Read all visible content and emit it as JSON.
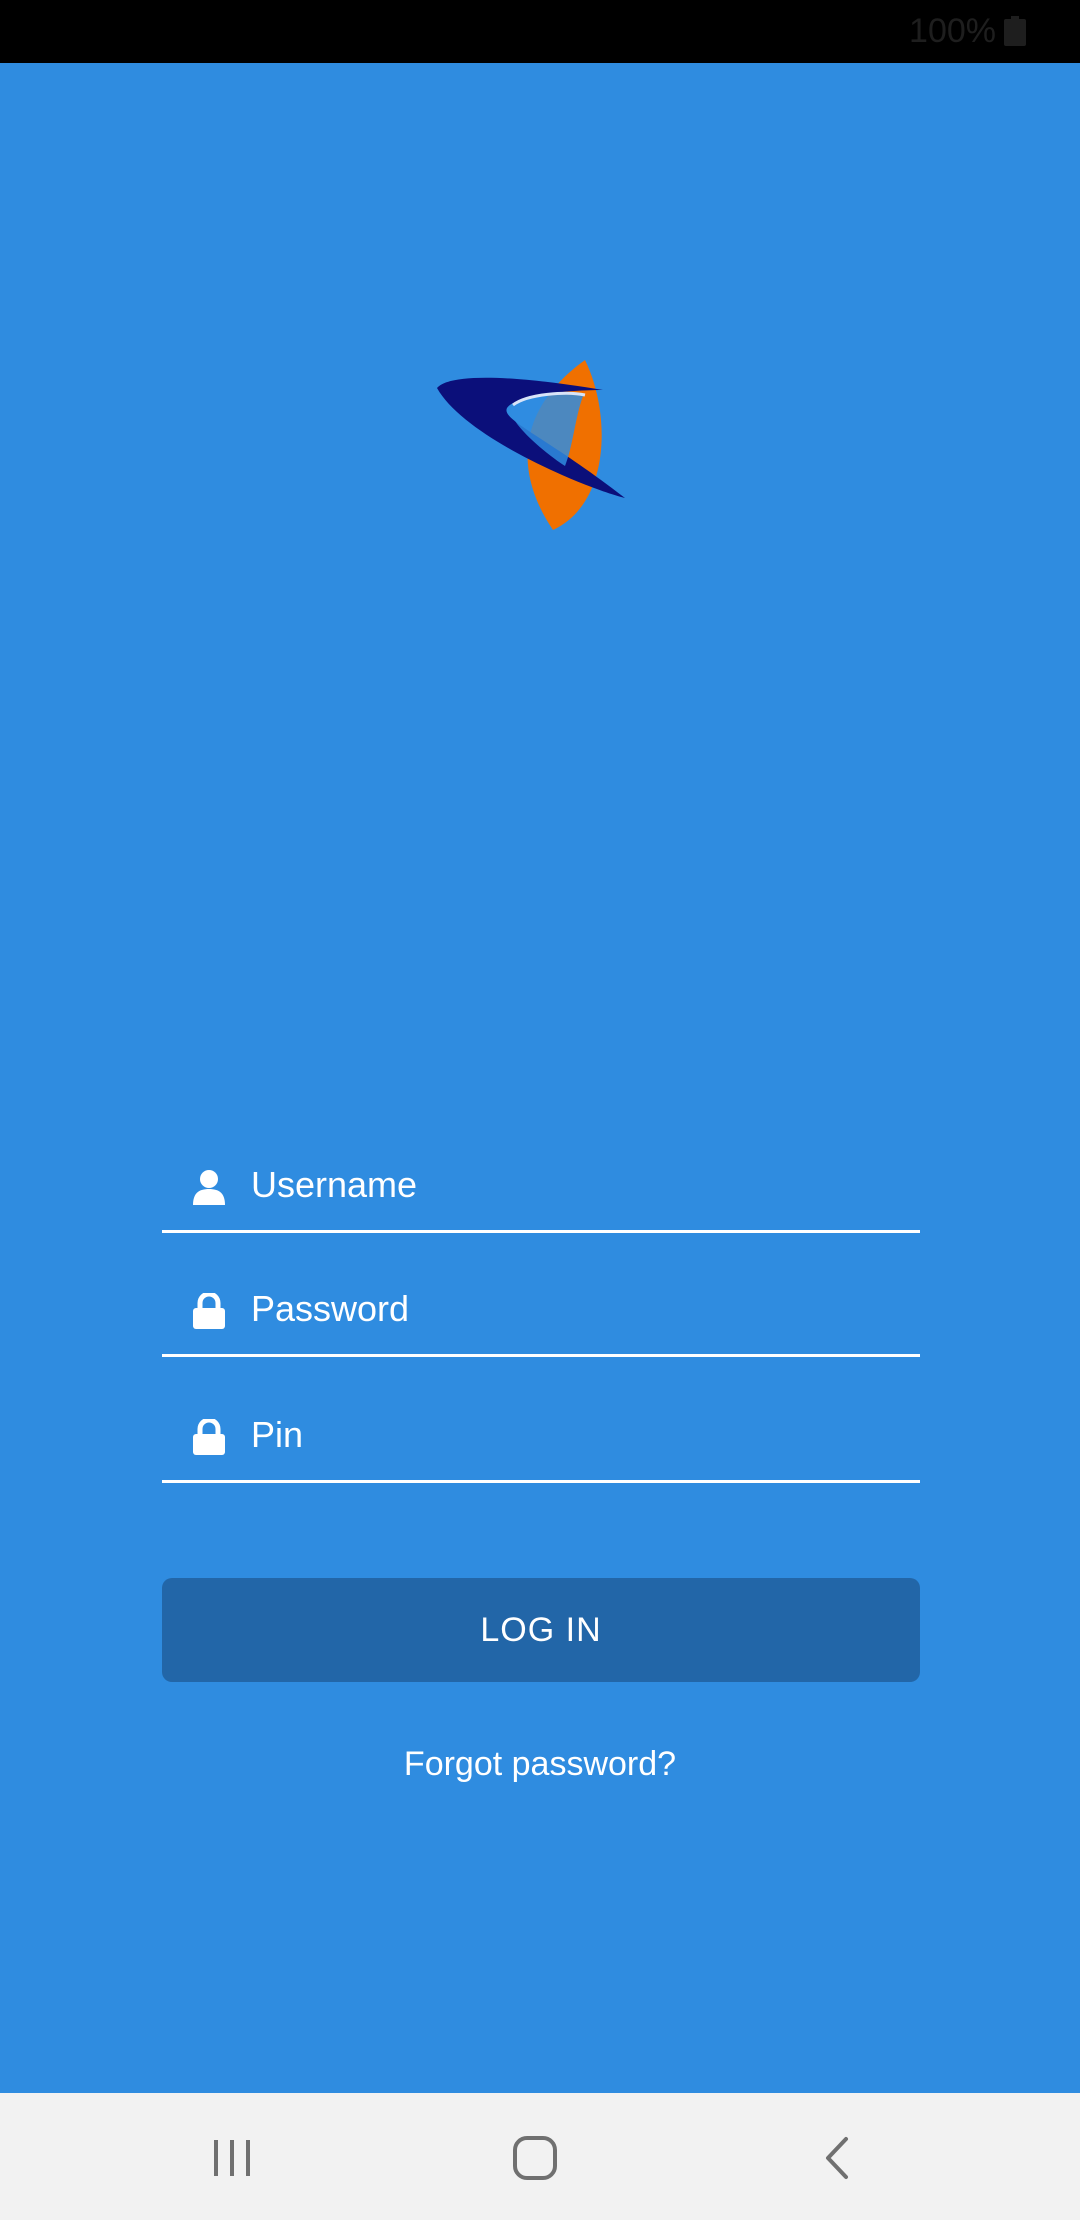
{
  "status_bar": {
    "battery_text": "100%",
    "battery_icon": "battery-icon"
  },
  "logo": {
    "icon": "company-logo"
  },
  "form": {
    "username": {
      "placeholder": "Username",
      "value": "",
      "icon": "user-icon"
    },
    "password": {
      "placeholder": "Password",
      "value": "",
      "icon": "lock-icon"
    },
    "pin": {
      "placeholder": "Pin",
      "value": "",
      "icon": "lock-icon"
    },
    "login_label": "LOG IN",
    "forgot_label": "Forgot password?"
  },
  "nav_bar": {
    "recents_icon": "recents-icon",
    "home_icon": "home-icon",
    "back_icon": "back-icon"
  },
  "colors": {
    "background": "#2f8ce0",
    "button": "#2266a8",
    "logo_navy": "#0b0f7a",
    "logo_orange": "#f07000"
  }
}
